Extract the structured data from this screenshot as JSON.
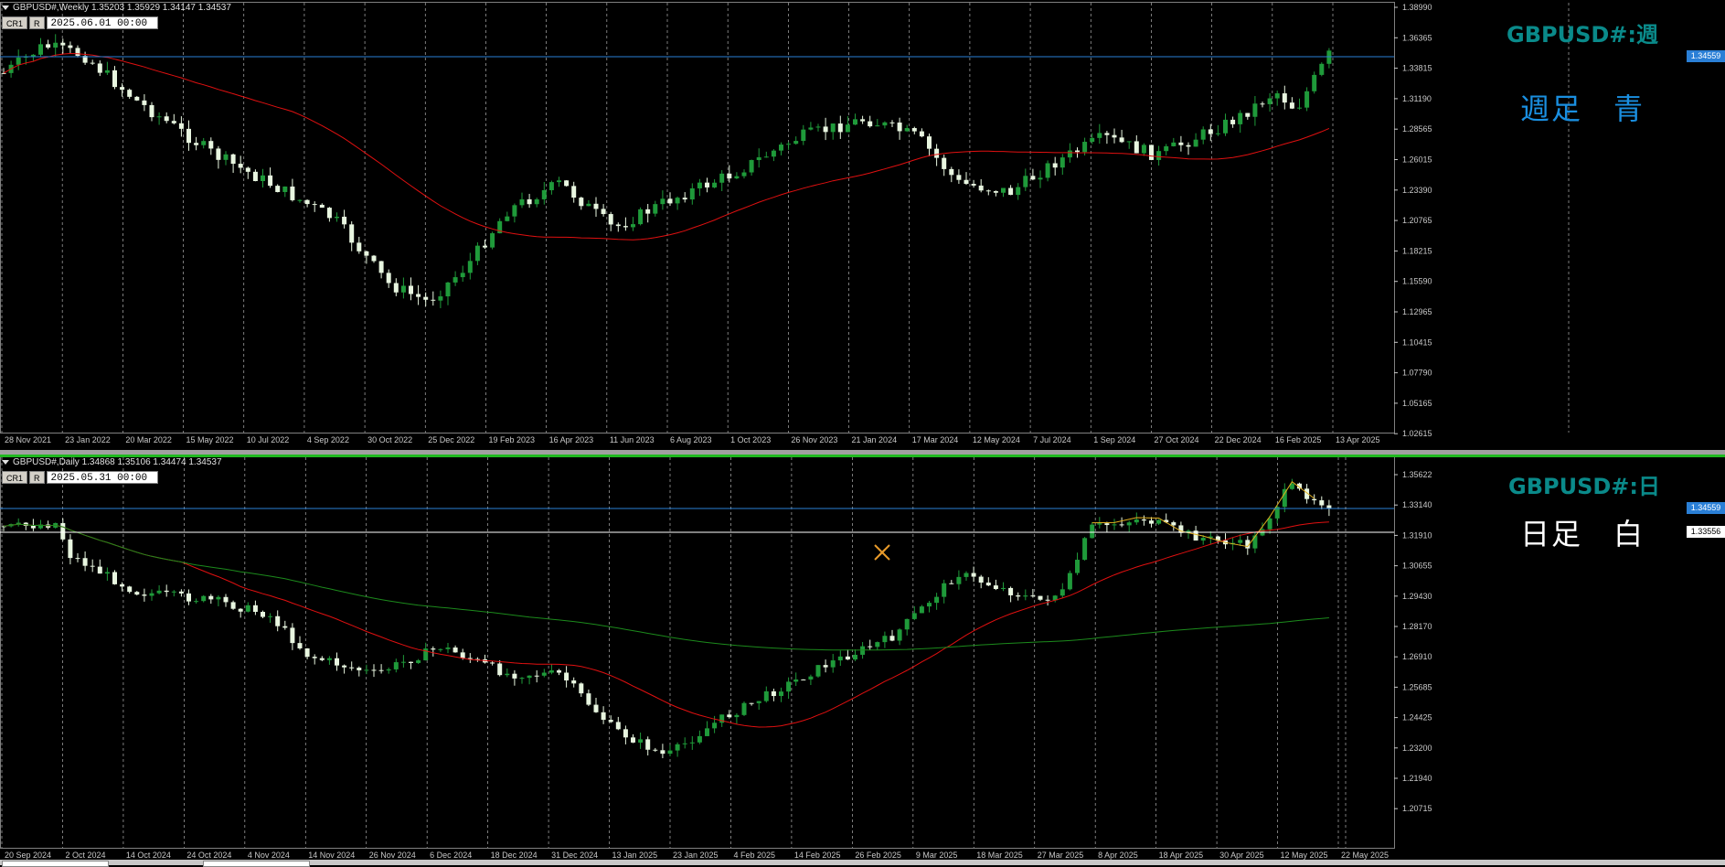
{
  "weekly": {
    "header": "GBPUSD#,Weekly  1.35203 1.35929 1.34147 1.34537",
    "controls": {
      "cr1": "CR1",
      "r": "R",
      "datetime": "2025.06.01 00:00"
    },
    "symbol_title": "GBPUSD#:週",
    "note": "週足　青",
    "note_color": "#1a8fe0",
    "current_price": "1.34559",
    "price_labels": [
      "1.38990",
      "1.36365",
      "1.33815",
      "1.31190",
      "1.28565",
      "1.26015",
      "1.23390",
      "1.20765",
      "1.18215",
      "1.15590",
      "1.12965",
      "1.10415",
      "1.07790",
      "1.05165",
      "1.02615"
    ],
    "date_labels": [
      "28 Nov 2021",
      "23 Jan 2022",
      "20 Mar 2022",
      "15 May 2022",
      "10 Jul 2022",
      "4 Sep 2022",
      "30 Oct 2022",
      "25 Dec 2022",
      "19 Feb 2023",
      "16 Apr 2023",
      "11 Jun 2023",
      "6 Aug 2023",
      "1 Oct 2023",
      "26 Nov 2023",
      "21 Jan 2024",
      "17 Mar 2024",
      "12 May 2024",
      "7 Jul 2024",
      "1 Sep 2024",
      "27 Oct 2024",
      "22 Dec 2024",
      "16 Feb 2025",
      "13 Apr 2025"
    ]
  },
  "daily": {
    "header": "GBPUSD#,Daily  1.34868 1.35106 1.34474 1.34537",
    "controls": {
      "cr1": "CR1",
      "r": "R",
      "datetime": "2025.05.31 00:00"
    },
    "symbol_title": "GBPUSD#:日",
    "note": "日足　白",
    "note_color": "#ffffff",
    "current_price": "1.34559",
    "hline_price": "1.33556",
    "price_labels": [
      "1.35622",
      "1.33140",
      "1.31910",
      "1.30655",
      "1.29430",
      "1.28170",
      "1.26910",
      "1.25685",
      "1.24425",
      "1.23200",
      "1.21940",
      "1.20715"
    ],
    "date_labels": [
      "20 Sep 2024",
      "2 Oct 2024",
      "14 Oct 2024",
      "24 Oct 2024",
      "4 Nov 2024",
      "14 Nov 2024",
      "26 Nov 2024",
      "6 Dec 2024",
      "18 Dec 2024",
      "31 Dec 2024",
      "13 Jan 2025",
      "23 Jan 2025",
      "4 Feb 2025",
      "14 Feb 2025",
      "26 Feb 2025",
      "9 Mar 2025",
      "18 Mar 2025",
      "27 Mar 2025",
      "8 Apr 2025",
      "18 Apr 2025",
      "30 Apr 2025",
      "12 May 2025",
      "22 May 2025"
    ]
  },
  "colors": {
    "bull": "#1f9a3a",
    "bear": "#e8f6e0",
    "ma_red": "#e01010",
    "ma_green": "#1c8a1c",
    "zigzag": "#e0b020",
    "current_line": "#2a7fd6",
    "hline": "#ffffff",
    "grid": "#b0b0b0",
    "axis_text": "#c8c8c8",
    "current_label_bg": "#2a7fd6"
  }
}
